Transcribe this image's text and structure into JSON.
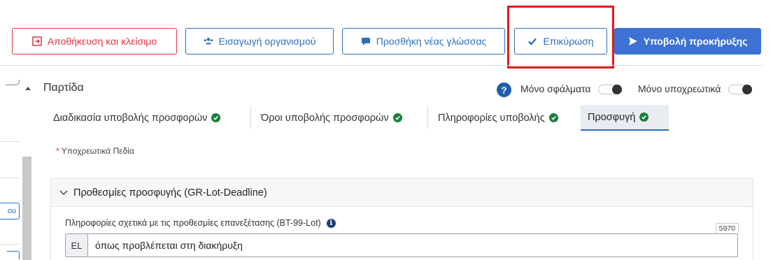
{
  "toolbar": {
    "save_close": "Αποθήκευση και κλείσιμο",
    "import_org": "Εισαγωγή οργανισμού",
    "add_language": "Προσθήκη νέας γλώσσας",
    "validate": "Επικύρωση",
    "submit_notice": "Υποβολή προκήρυξης"
  },
  "left_panel": {
    "stub_label": "ου"
  },
  "section": {
    "title": "Παρτίδα",
    "errors_only": "Μόνο σφάλματα",
    "required_only": "Μόνο υποχρεωτικά"
  },
  "tabs": [
    {
      "label": "Διαδικασία υποβολής προσφορών"
    },
    {
      "label": "Όροι υποβολής προσφορών"
    },
    {
      "label": "Πληροφορίες υποβολής"
    },
    {
      "label": "Προσφυγή"
    }
  ],
  "required_note": {
    "star": "*",
    "text": "Υποχρεωτικά Πεδία"
  },
  "card": {
    "title": "Προθεσμίες προσφυγής (GR-Lot-Deadline)",
    "field_label": "Πληροφορίες σχετικά με τις προθεσμίες επανεξέτασης (BT-99-Lot)",
    "char_count": "5970",
    "lang": "EL",
    "value": "όπως προβλέπεται στη διακήρυξη"
  },
  "colors": {
    "danger": "#dc3545",
    "primary": "#2c6fbb",
    "submit_bg": "#3d72d4",
    "success": "#1a7f3c",
    "highlight": "#e01b1b"
  },
  "icons": [
    "sign-out-icon",
    "users-icon",
    "comment-icon",
    "check-icon",
    "send-icon",
    "help-icon",
    "chevron-down-icon",
    "info-icon",
    "check-circle-icon"
  ]
}
